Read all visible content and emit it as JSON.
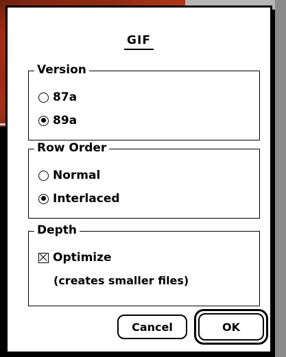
{
  "dialog": {
    "title": "GIF",
    "version": {
      "label": "Version",
      "options": [
        {
          "label": "87a",
          "selected": false
        },
        {
          "label": "89a",
          "selected": true
        }
      ]
    },
    "row_order": {
      "label": "Row Order",
      "options": [
        {
          "label": "Normal",
          "selected": false
        },
        {
          "label": "Interlaced",
          "selected": true
        }
      ]
    },
    "depth": {
      "label": "Depth",
      "optimize_label": "Optimize",
      "optimize_checked": true,
      "note": "(creates smaller files)"
    },
    "buttons": {
      "cancel": "Cancel",
      "ok": "OK"
    }
  }
}
